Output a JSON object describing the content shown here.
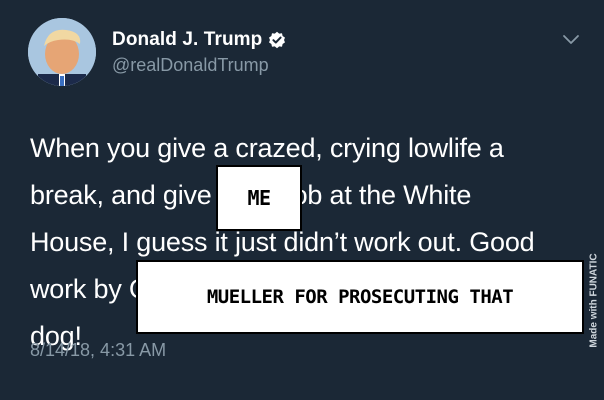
{
  "author": {
    "display_name": "Donald J. Trump",
    "handle": "@realDonaldTrump",
    "verified_icon": "verified-badge-icon"
  },
  "tweet": {
    "text": "When you give a crazed, crying lowlife a\nbreak, and give her a job at the White\nHouse, I guess it just didn’t work out. Good\nwork by General Kelly for quickly firing that\ndog!",
    "timestamp": "8/14/18, 4:31 AM"
  },
  "captions": {
    "me": "ME",
    "mueller": "MUELLER FOR PROSECUTING THAT"
  },
  "watermark": {
    "text": "Made with FUNATIC"
  },
  "colors": {
    "background": "#1b2836",
    "secondary_text": "#8899a6",
    "verified_blue": "#ffffff"
  }
}
